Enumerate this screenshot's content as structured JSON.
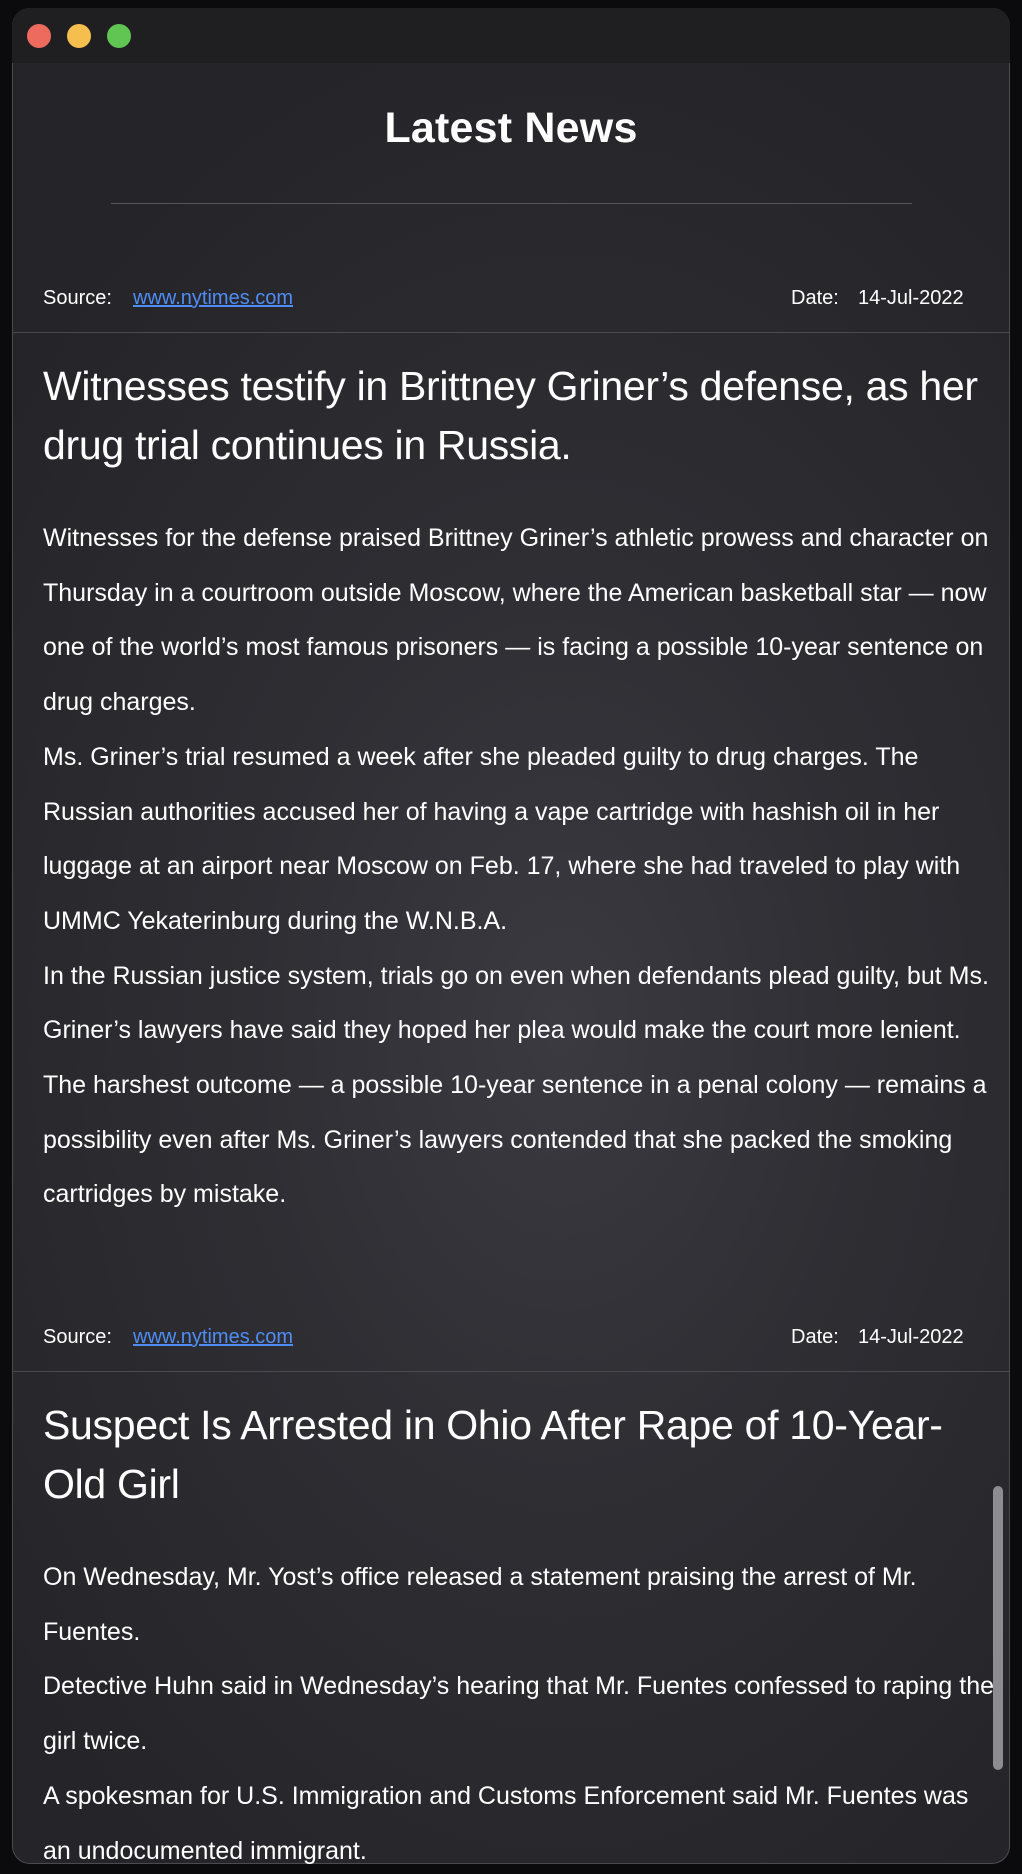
{
  "header": {
    "title": "Latest News"
  },
  "articles": [
    {
      "source_label": "Source:",
      "source_link": "www.nytimes.com",
      "date_label": "Date:",
      "date": "14-Jul-2022",
      "headline": "Witnesses testify in Brittney Griner’s defense, as her drug trial continues in Russia.",
      "paragraphs": [
        "Witnesses for the defense praised Brittney Griner’s athletic prowess and character on Thursday in a courtroom outside Moscow, where the American basketball star — now one of the world’s most famous prisoners — is facing a possible 10-year sentence on drug charges.",
        "Ms. Griner’s trial resumed a week after she pleaded guilty to drug charges. The Russian authorities accused her of having a vape cartridge with hashish oil in her luggage at an airport near Moscow on Feb. 17, where she had traveled to play with UMMC Yekaterinburg during the W.N.B.A.",
        "In the Russian justice system, trials go on even when defendants plead guilty, but Ms. Griner’s lawyers have said they hoped her plea would make the court more lenient.",
        "The harshest outcome — a possible 10-year sentence in a penal colony — remains a possibility even after Ms. Griner’s lawyers contended that she packed the smoking cartridges by mistake."
      ]
    },
    {
      "source_label": "Source:",
      "source_link": "www.nytimes.com",
      "date_label": "Date:",
      "date": "14-Jul-2022",
      "headline": "Suspect Is Arrested in Ohio After Rape of 10-Year-Old Girl",
      "paragraphs": [
        "On Wednesday, Mr. Yost’s office released a statement praising the arrest of Mr. Fuentes.",
        "Detective Huhn said in Wednesday’s hearing that Mr. Fuentes confessed to raping the girl twice.",
        "A spokesman for U.S. Immigration and Customs Enforcement said Mr. Fuentes was an undocumented immigrant."
      ]
    }
  ],
  "colors": {
    "window_background": "#2e2e33",
    "link": "#4e8df5",
    "text": "#ffffff",
    "close_button": "#ed6a5e",
    "minimize_button": "#f5bf4f",
    "zoom_button": "#61c554"
  }
}
